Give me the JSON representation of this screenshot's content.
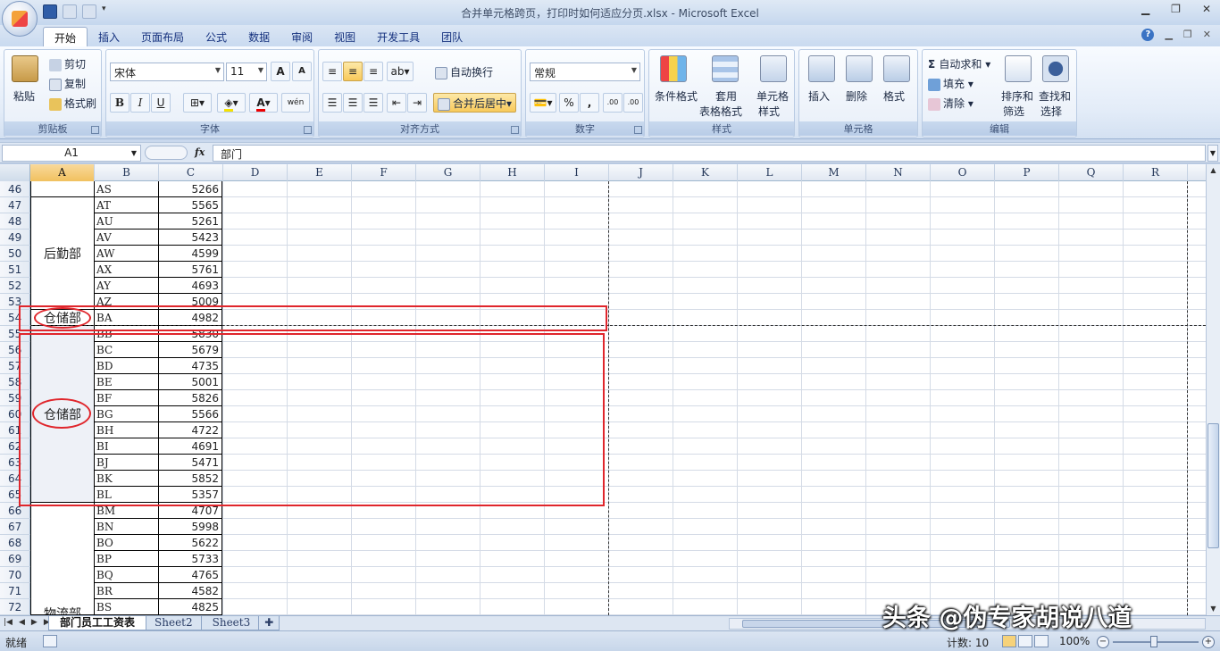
{
  "window": {
    "title": "合并单元格跨页，打印时如何适应分页.xlsx - Microsoft Excel"
  },
  "ribbon_tabs": [
    "开始",
    "插入",
    "页面布局",
    "公式",
    "数据",
    "审阅",
    "视图",
    "开发工具",
    "团队"
  ],
  "ribbon": {
    "clipboard": {
      "paste": "粘贴",
      "cut": "剪切",
      "copy": "复制",
      "format_painter": "格式刷",
      "label": "剪贴板"
    },
    "font": {
      "name": "宋体",
      "size": "11",
      "label": "字体",
      "bold": "B",
      "italic": "I",
      "underline": "U",
      "grow": "A",
      "shrink": "A",
      "wen": "wén"
    },
    "alignment": {
      "wrap": "自动换行",
      "merge": "合并后居中",
      "label": "对齐方式"
    },
    "number": {
      "format": "常规",
      "percent": "%",
      "comma": ",",
      "inc": ".00",
      "dec": ".00",
      "label": "数字"
    },
    "styles": {
      "cond_format": "条件格式",
      "table_format_1": "套用",
      "table_format_2": "表格格式",
      "cell_style_1": "单元格",
      "cell_style_2": "样式",
      "label": "样式"
    },
    "cells": {
      "insert": "插入",
      "delete": "删除",
      "format": "格式",
      "label": "单元格"
    },
    "editing": {
      "autosum": "自动求和",
      "fill": "填充",
      "clear": "清除",
      "sort_1": "排序和",
      "sort_2": "筛选",
      "find_1": "查找和",
      "find_2": "选择",
      "label": "编辑"
    }
  },
  "formula_bar": {
    "name_box": "A1",
    "fx": "fx",
    "content": "部门"
  },
  "columns": [
    "A",
    "B",
    "C",
    "D",
    "E",
    "F",
    "G",
    "H",
    "I",
    "J",
    "K",
    "L",
    "M",
    "N",
    "O",
    "P",
    "Q",
    "R"
  ],
  "rows": [
    "46",
    "47",
    "48",
    "49",
    "50",
    "51",
    "52",
    "53",
    "54",
    "55",
    "56",
    "57",
    "58",
    "59",
    "60",
    "61",
    "62",
    "63",
    "64",
    "65",
    "66",
    "67",
    "68",
    "69",
    "70",
    "71",
    "72"
  ],
  "data_rows": [
    {
      "b": "AS",
      "c": "5266"
    },
    {
      "b": "AT",
      "c": "5565"
    },
    {
      "b": "AU",
      "c": "5261"
    },
    {
      "b": "AV",
      "c": "5423"
    },
    {
      "b": "AW",
      "c": "4599"
    },
    {
      "b": "AX",
      "c": "5761"
    },
    {
      "b": "AY",
      "c": "4693"
    },
    {
      "b": "AZ",
      "c": "5009"
    },
    {
      "b": "BA",
      "c": "4982"
    },
    {
      "b": "BB",
      "c": "5830"
    },
    {
      "b": "BC",
      "c": "5679"
    },
    {
      "b": "BD",
      "c": "4735"
    },
    {
      "b": "BE",
      "c": "5001"
    },
    {
      "b": "BF",
      "c": "5826"
    },
    {
      "b": "BG",
      "c": "5566"
    },
    {
      "b": "BH",
      "c": "4722"
    },
    {
      "b": "BI",
      "c": "4691"
    },
    {
      "b": "BJ",
      "c": "5471"
    },
    {
      "b": "BK",
      "c": "5852"
    },
    {
      "b": "BL",
      "c": "5357"
    },
    {
      "b": "BM",
      "c": "4707"
    },
    {
      "b": "BN",
      "c": "5998"
    },
    {
      "b": "BO",
      "c": "5622"
    },
    {
      "b": "BP",
      "c": "5733"
    },
    {
      "b": "BQ",
      "c": "4765"
    },
    {
      "b": "BR",
      "c": "4582"
    },
    {
      "b": "BS",
      "c": "4825"
    }
  ],
  "merged_departments": {
    "logistics": "后勤部",
    "warehouse_top": "仓储部",
    "warehouse_bottom": "仓储部",
    "materials": "物流部"
  },
  "sheet_tabs": [
    "部门员工工资表",
    "Sheet2",
    "Sheet3"
  ],
  "status": {
    "ready": "就绪",
    "count": "计数: 10",
    "zoom": "100%"
  },
  "watermark": "头条 @伪专家胡说八道",
  "colors": {
    "red_annotation": "#e0262c",
    "selected_header": "#f1c15f",
    "ribbon_bg": "#dbe6f4"
  }
}
